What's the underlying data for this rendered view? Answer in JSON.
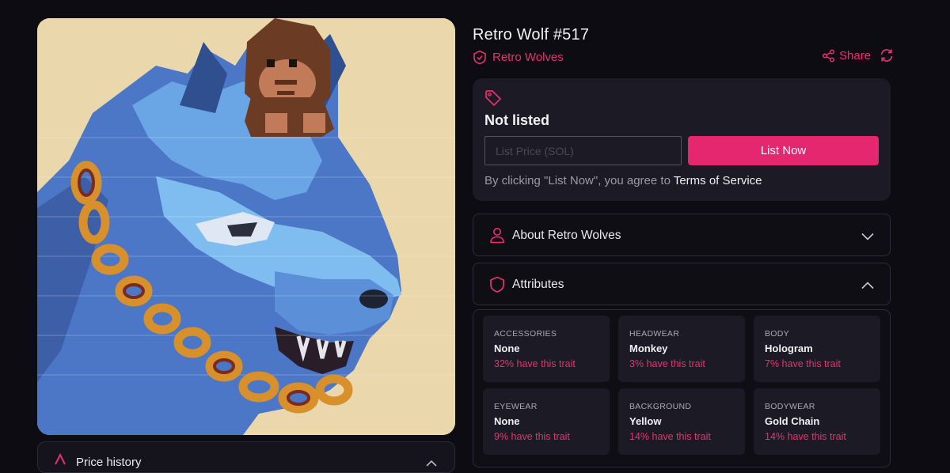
{
  "nft": {
    "title": "Retro Wolf #517",
    "collection": "Retro Wolves"
  },
  "actions": {
    "share_label": "Share"
  },
  "listing": {
    "status": "Not listed",
    "price_placeholder": "List Price (SOL)",
    "list_button": "List Now",
    "agree_text": "By clicking \"List Now\", you agree to",
    "terms_link": "Terms of Service"
  },
  "about": {
    "label": "About Retro Wolves"
  },
  "attributes": {
    "label": "Attributes",
    "traits": [
      {
        "type": "ACCESSORIES",
        "value": "None",
        "rarity": "32% have this trait"
      },
      {
        "type": "HEADWEAR",
        "value": "Monkey",
        "rarity": "3% have this trait"
      },
      {
        "type": "BODY",
        "value": "Hologram",
        "rarity": "7% have this trait"
      },
      {
        "type": "EYEWEAR",
        "value": "None",
        "rarity": "9% have this trait"
      },
      {
        "type": "BACKGROUND",
        "value": "Yellow",
        "rarity": "14% have this trait"
      },
      {
        "type": "BODYWEAR",
        "value": "Gold Chain",
        "rarity": "14% have this trait"
      }
    ]
  },
  "price_history": {
    "label": "Price history"
  },
  "colors": {
    "accent": "#e4276e",
    "background": "#0d0c12",
    "card": "#1c1b25"
  },
  "icons": {
    "collection": "shield-check-icon",
    "share": "share-icon",
    "refresh": "refresh-icon",
    "tag": "tag-icon",
    "about": "user-icon",
    "attributes": "shield-icon",
    "price_history": "chart-icon",
    "chevron_down": "chevron-down-icon",
    "chevron_up": "chevron-up-icon"
  }
}
